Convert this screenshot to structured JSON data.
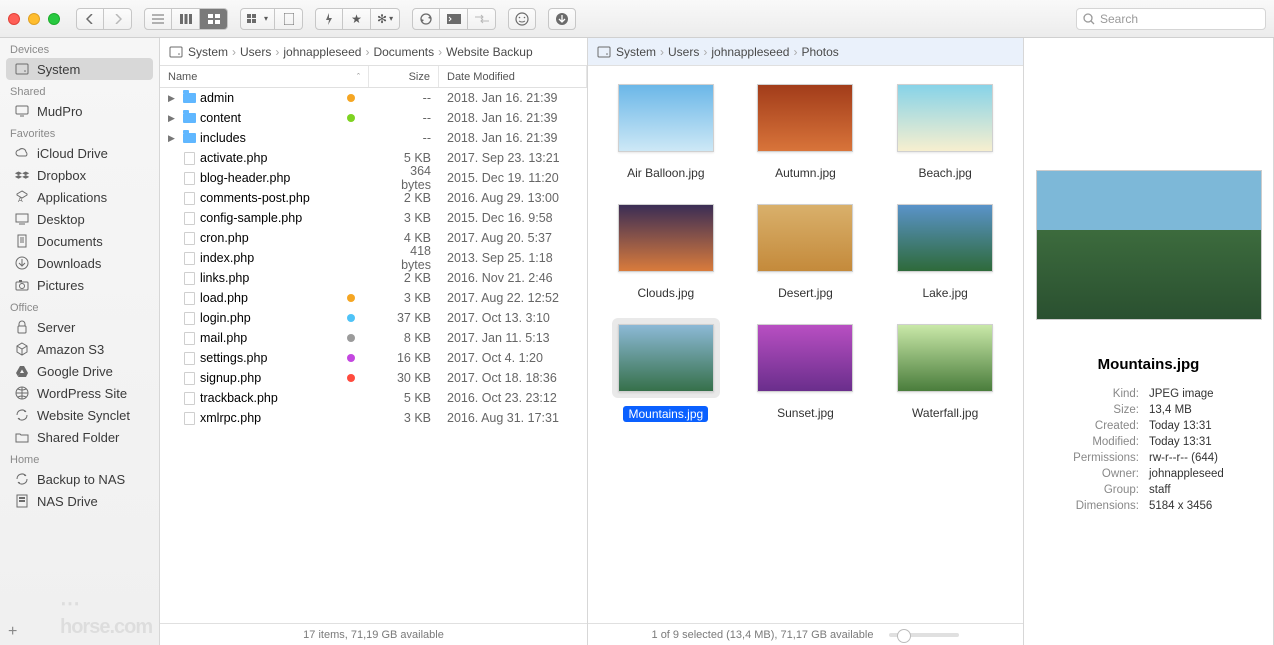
{
  "search_placeholder": "Search",
  "sidebar": {
    "sections": [
      {
        "title": "Devices",
        "items": [
          {
            "label": "System",
            "icon": "hdd",
            "selected": true
          }
        ]
      },
      {
        "title": "Shared",
        "items": [
          {
            "label": "MudPro",
            "icon": "monitor"
          }
        ]
      },
      {
        "title": "Favorites",
        "items": [
          {
            "label": "iCloud Drive",
            "icon": "cloud"
          },
          {
            "label": "Dropbox",
            "icon": "dropbox"
          },
          {
            "label": "Applications",
            "icon": "apps"
          },
          {
            "label": "Desktop",
            "icon": "desktop"
          },
          {
            "label": "Documents",
            "icon": "doc"
          },
          {
            "label": "Downloads",
            "icon": "download"
          },
          {
            "label": "Pictures",
            "icon": "camera"
          }
        ]
      },
      {
        "title": "Office",
        "items": [
          {
            "label": "Server",
            "icon": "lock"
          },
          {
            "label": "Amazon S3",
            "icon": "cube"
          },
          {
            "label": "Google Drive",
            "icon": "gdrive"
          },
          {
            "label": "WordPress Site",
            "icon": "globe"
          },
          {
            "label": "Website Synclet",
            "icon": "sync"
          },
          {
            "label": "Shared Folder",
            "icon": "folder"
          }
        ]
      },
      {
        "title": "Home",
        "items": [
          {
            "label": "Backup to NAS",
            "icon": "sync"
          },
          {
            "label": "NAS Drive",
            "icon": "nas"
          }
        ]
      }
    ]
  },
  "leftPane": {
    "path": [
      "System",
      "Users",
      "johnappleseed",
      "Documents",
      "Website Backup"
    ],
    "columns": {
      "name": "Name",
      "size": "Size",
      "date": "Date Modified"
    },
    "rows": [
      {
        "name": "admin",
        "type": "folder",
        "tag": "#f5a623",
        "size": "--",
        "date": "2018. Jan 16. 21:39",
        "expandable": true
      },
      {
        "name": "content",
        "type": "folder",
        "tag": "#7ed321",
        "size": "--",
        "date": "2018. Jan 16. 21:39",
        "expandable": true
      },
      {
        "name": "includes",
        "type": "folder",
        "tag": null,
        "size": "--",
        "date": "2018. Jan 16. 21:39",
        "expandable": true
      },
      {
        "name": "activate.php",
        "type": "file",
        "size": "5 KB",
        "date": "2017. Sep 23. 13:21"
      },
      {
        "name": "blog-header.php",
        "type": "file",
        "size": "364 bytes",
        "date": "2015. Dec 19. 11:20"
      },
      {
        "name": "comments-post.php",
        "type": "file",
        "size": "2 KB",
        "date": "2016. Aug 29. 13:00"
      },
      {
        "name": "config-sample.php",
        "type": "file",
        "size": "3 KB",
        "date": "2015. Dec 16. 9:58"
      },
      {
        "name": "cron.php",
        "type": "file",
        "size": "4 KB",
        "date": "2017. Aug 20. 5:37"
      },
      {
        "name": "index.php",
        "type": "file",
        "size": "418 bytes",
        "date": "2013. Sep 25. 1:18"
      },
      {
        "name": "links.php",
        "type": "file",
        "size": "2 KB",
        "date": "2016. Nov 21. 2:46"
      },
      {
        "name": "load.php",
        "type": "file",
        "tag": "#f5a623",
        "size": "3 KB",
        "date": "2017. Aug 22. 12:52"
      },
      {
        "name": "login.php",
        "type": "file",
        "tag": "#4fc3f7",
        "size": "37 KB",
        "date": "2017. Oct 13. 3:10"
      },
      {
        "name": "mail.php",
        "type": "file",
        "tag": "#9b9b9b",
        "size": "8 KB",
        "date": "2017. Jan 11. 5:13"
      },
      {
        "name": "settings.php",
        "type": "file",
        "tag": "#c447e0",
        "size": "16 KB",
        "date": "2017. Oct 4. 1:20"
      },
      {
        "name": "signup.php",
        "type": "file",
        "tag": "#ff4b3e",
        "size": "30 KB",
        "date": "2017. Oct 18. 18:36"
      },
      {
        "name": "trackback.php",
        "type": "file",
        "size": "5 KB",
        "date": "2016. Oct 23. 23:12"
      },
      {
        "name": "xmlrpc.php",
        "type": "file",
        "size": "3 KB",
        "date": "2016. Aug 31. 17:31"
      }
    ],
    "status": "17 items, 71,19 GB available"
  },
  "midPane": {
    "path": [
      "System",
      "Users",
      "johnappleseed",
      "Photos"
    ],
    "items": [
      {
        "label": "Air Balloon.jpg",
        "bg": "linear-gradient(#6bb7e8,#cde8f6)"
      },
      {
        "label": "Autumn.jpg",
        "bg": "linear-gradient(#a23c1a,#d8743a)"
      },
      {
        "label": "Beach.jpg",
        "bg": "linear-gradient(#87d3e8,#f7efcf)"
      },
      {
        "label": "Clouds.jpg",
        "bg": "linear-gradient(#3b2d55,#d97b3c)"
      },
      {
        "label": "Desert.jpg",
        "bg": "linear-gradient(#d9b06b,#c48a3b)"
      },
      {
        "label": "Lake.jpg",
        "bg": "linear-gradient(#5a93c9,#2e6a3a)"
      },
      {
        "label": "Mountains.jpg",
        "bg": "linear-gradient(#8cb9d6,#36704a)",
        "selected": true
      },
      {
        "label": "Sunset.jpg",
        "bg": "linear-gradient(#b84fc2,#6a2e8c)"
      },
      {
        "label": "Waterfall.jpg",
        "bg": "linear-gradient(#c9e8a8,#4a7d3c)"
      }
    ],
    "status": "1 of 9 selected (13,4 MB), 71,17 GB available"
  },
  "rightPane": {
    "name": "Mountains.jpg",
    "meta": [
      {
        "k": "Kind:",
        "v": "JPEG image"
      },
      {
        "k": "Size:",
        "v": "13,4 MB"
      },
      {
        "k": "Created:",
        "v": "Today 13:31"
      },
      {
        "k": "Modified:",
        "v": "Today 13:31"
      },
      {
        "k": "Permissions:",
        "v": "rw-r--r-- (644)"
      },
      {
        "k": "Owner:",
        "v": "johnappleseed"
      },
      {
        "k": "Group:",
        "v": "staff"
      },
      {
        "k": "Dimensions:",
        "v": "5184 x 3456"
      }
    ]
  }
}
